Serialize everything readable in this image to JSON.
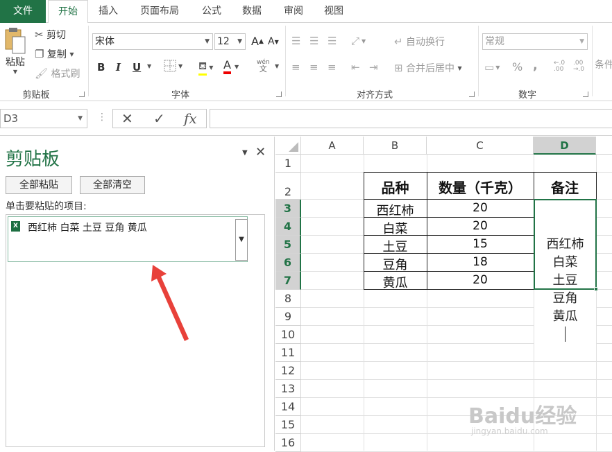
{
  "tabs": [
    "文件",
    "开始",
    "插入",
    "页面布局",
    "公式",
    "数据",
    "审阅",
    "视图"
  ],
  "ribbon": {
    "clipboard": {
      "paste": "粘贴",
      "cut": "剪切",
      "copy": "复制",
      "format_painter": "格式刷",
      "label": "剪贴板"
    },
    "font": {
      "name": "宋体",
      "size": "12",
      "grow": "A",
      "shrink": "A",
      "bold": "B",
      "italic": "I",
      "underline": "U",
      "font_color_letter": "A",
      "phonetic": "wén",
      "label": "字体"
    },
    "alignment": {
      "wrap": "自动换行",
      "merge": "合并后居中",
      "label": "对齐方式"
    },
    "number": {
      "format": "常规",
      "percent": "%",
      "comma": ",",
      "label": "数字"
    },
    "styles": {
      "conditional": "条件"
    }
  },
  "formula_bar": {
    "name_box": "D3",
    "cancel": "✕",
    "enter": "✓",
    "fx": "fx",
    "value": ""
  },
  "clipboard_pane": {
    "title": "剪贴板",
    "paste_all": "全部粘贴",
    "clear_all": "全部清空",
    "hint": "单击要粘贴的项目:",
    "item_text": "西红柿 白菜 土豆 豆角 黄瓜",
    "item_icon": "excel-icon"
  },
  "sheet": {
    "columns": [
      "A",
      "B",
      "C",
      "D"
    ],
    "rows": [
      "1",
      "2",
      "3",
      "4",
      "5",
      "6",
      "7",
      "8",
      "9",
      "10",
      "11",
      "12",
      "13",
      "14",
      "15",
      "16"
    ],
    "header": [
      "品种",
      "数量（千克）",
      "备注"
    ],
    "data": [
      [
        "西红柿",
        "20"
      ],
      [
        "白菜",
        "20"
      ],
      [
        "土豆",
        "15"
      ],
      [
        "豆角",
        "18"
      ],
      [
        "黄瓜",
        "20"
      ]
    ],
    "note_lines": [
      "西红柿",
      "白菜",
      "土豆",
      "豆角",
      "黄瓜"
    ]
  },
  "watermark": {
    "brand": "Baidu经验",
    "url": "jingyan.baidu.com"
  },
  "colors": {
    "accent": "#217346",
    "arrow": "#e8413a"
  }
}
